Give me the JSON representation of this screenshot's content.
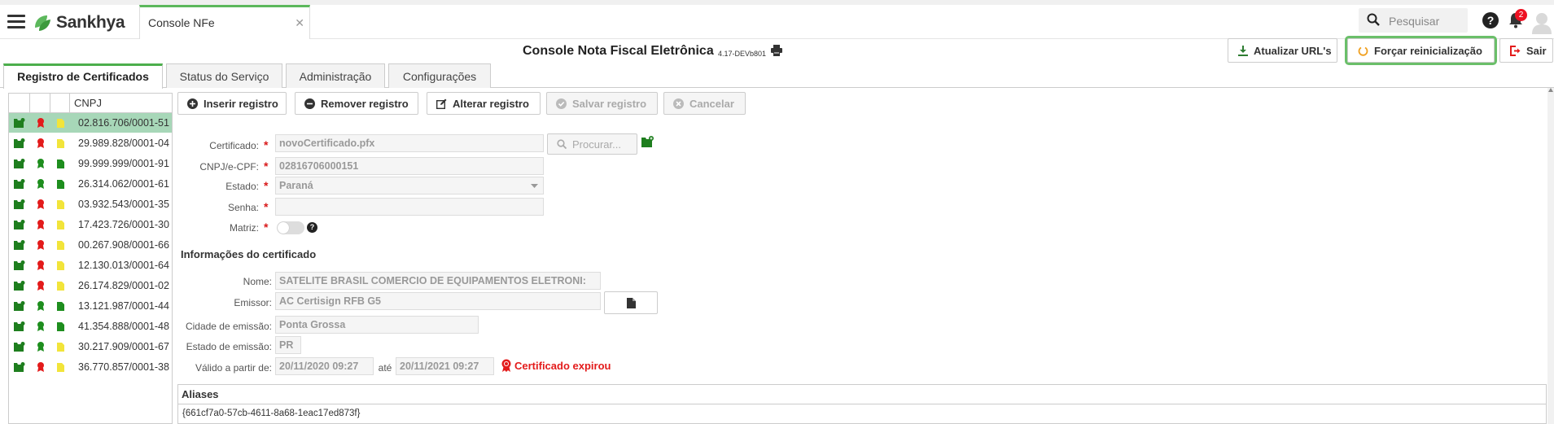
{
  "topbar": {
    "brand": "Sankhya",
    "app_tab": "Console NFe",
    "app_tab_close": "✕",
    "search_placeholder": "Pesquisar",
    "notification_count": "2",
    "help_glyph": "?"
  },
  "header": {
    "title": "Console Nota Fiscal Eletrônica",
    "version": "4.17-DEVb801",
    "atualizar_label": "Atualizar URL's",
    "forcar_label": "Forçar reinicialização",
    "sair_label": "Sair"
  },
  "tabs": [
    {
      "label": "Registro de Certificados"
    },
    {
      "label": "Status do Serviço"
    },
    {
      "label": "Administração"
    },
    {
      "label": "Configurações"
    }
  ],
  "grid": {
    "column_header": "CNPJ",
    "rows": [
      {
        "cnpj": "02.816.706/0001-51",
        "status": "red",
        "doc": "yellow"
      },
      {
        "cnpj": "29.989.828/0001-04",
        "status": "red",
        "doc": "yellow"
      },
      {
        "cnpj": "99.999.999/0001-91",
        "status": "green",
        "doc": "green"
      },
      {
        "cnpj": "26.314.062/0001-61",
        "status": "green",
        "doc": "green"
      },
      {
        "cnpj": "03.932.543/0001-35",
        "status": "red",
        "doc": "yellow"
      },
      {
        "cnpj": "17.423.726/0001-30",
        "status": "red",
        "doc": "yellow"
      },
      {
        "cnpj": "00.267.908/0001-66",
        "status": "red",
        "doc": "yellow"
      },
      {
        "cnpj": "12.130.013/0001-64",
        "status": "red",
        "doc": "yellow"
      },
      {
        "cnpj": "26.174.829/0001-02",
        "status": "red",
        "doc": "yellow"
      },
      {
        "cnpj": "13.121.987/0001-44",
        "status": "green",
        "doc": "green"
      },
      {
        "cnpj": "41.354.888/0001-48",
        "status": "green",
        "doc": "green"
      },
      {
        "cnpj": "30.217.909/0001-67",
        "status": "green",
        "doc": "yellow"
      },
      {
        "cnpj": "36.770.857/0001-38",
        "status": "red",
        "doc": "yellow"
      }
    ]
  },
  "toolbar": {
    "inserir": "Inserir registro",
    "remover": "Remover registro",
    "alterar": "Alterar registro",
    "salvar": "Salvar registro",
    "cancelar": "Cancelar"
  },
  "form": {
    "certificado_label": "Certificado:",
    "certificado_value": "novoCertificado.pfx",
    "procurar_label": "Procurar...",
    "cnpj_label": "CNPJ/e-CPF:",
    "cnpj_value": "02816706000151",
    "estado_label": "Estado:",
    "estado_value": "Paraná",
    "senha_label": "Senha:",
    "senha_value": "",
    "matriz_label": "Matriz:",
    "required_mark": "*"
  },
  "info": {
    "section_title": "Informações do certificado",
    "nome_label": "Nome:",
    "nome_value": "SATELITE BRASIL COMERCIO DE EQUIPAMENTOS ELETRONI:",
    "emissor_label": "Emissor:",
    "emissor_value": "AC Certisign RFB G5",
    "cidade_label": "Cidade de emissão:",
    "cidade_value": "Ponta Grossa",
    "estado_emissao_label": "Estado de emissão:",
    "estado_emissao_value": "PR",
    "valido_label": "Válido a partir de:",
    "valido_de": "20/11/2020 09:27",
    "ate_label": "até",
    "valido_ate": "20/11/2021 09:27",
    "expirou_label": "Certificado expirou"
  },
  "aliases": {
    "header": "Aliases",
    "value": "{661cf7a0-57cb-4611-8a68-1eac17ed873f}"
  },
  "colors": {
    "accent_green": "#4cae4c",
    "selected_row": "#a7d7b8",
    "error_red": "#e31b1b",
    "highlight_outline": "#6abf69"
  }
}
